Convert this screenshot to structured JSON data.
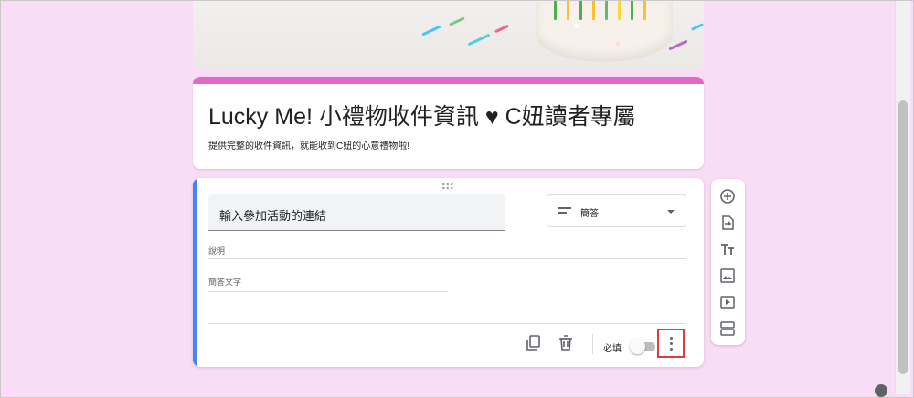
{
  "form": {
    "title": "Lucky Me!  小禮物收件資訊 ♥ C妞讀者專屬",
    "description": "提供完整的收件資訊，就能收到C妞的心意禮物啦!",
    "accent_color": "#e468c8",
    "background_color": "#f9dcf5"
  },
  "question": {
    "title_value": "輸入參加活動的連結",
    "type_label": "簡答",
    "description_placeholder": "說明",
    "answer_placeholder": "簡答文字",
    "required_label": "必填",
    "required_on": false,
    "active_color": "#4285f4"
  },
  "question_actions": [
    "copy-icon",
    "trash-icon",
    "more-vert-icon"
  ],
  "toolbar": [
    "add-question-icon",
    "import-questions-icon",
    "add-title-icon",
    "add-image-icon",
    "add-video-icon",
    "add-section-icon"
  ],
  "highlight_color": "#e03a3a"
}
